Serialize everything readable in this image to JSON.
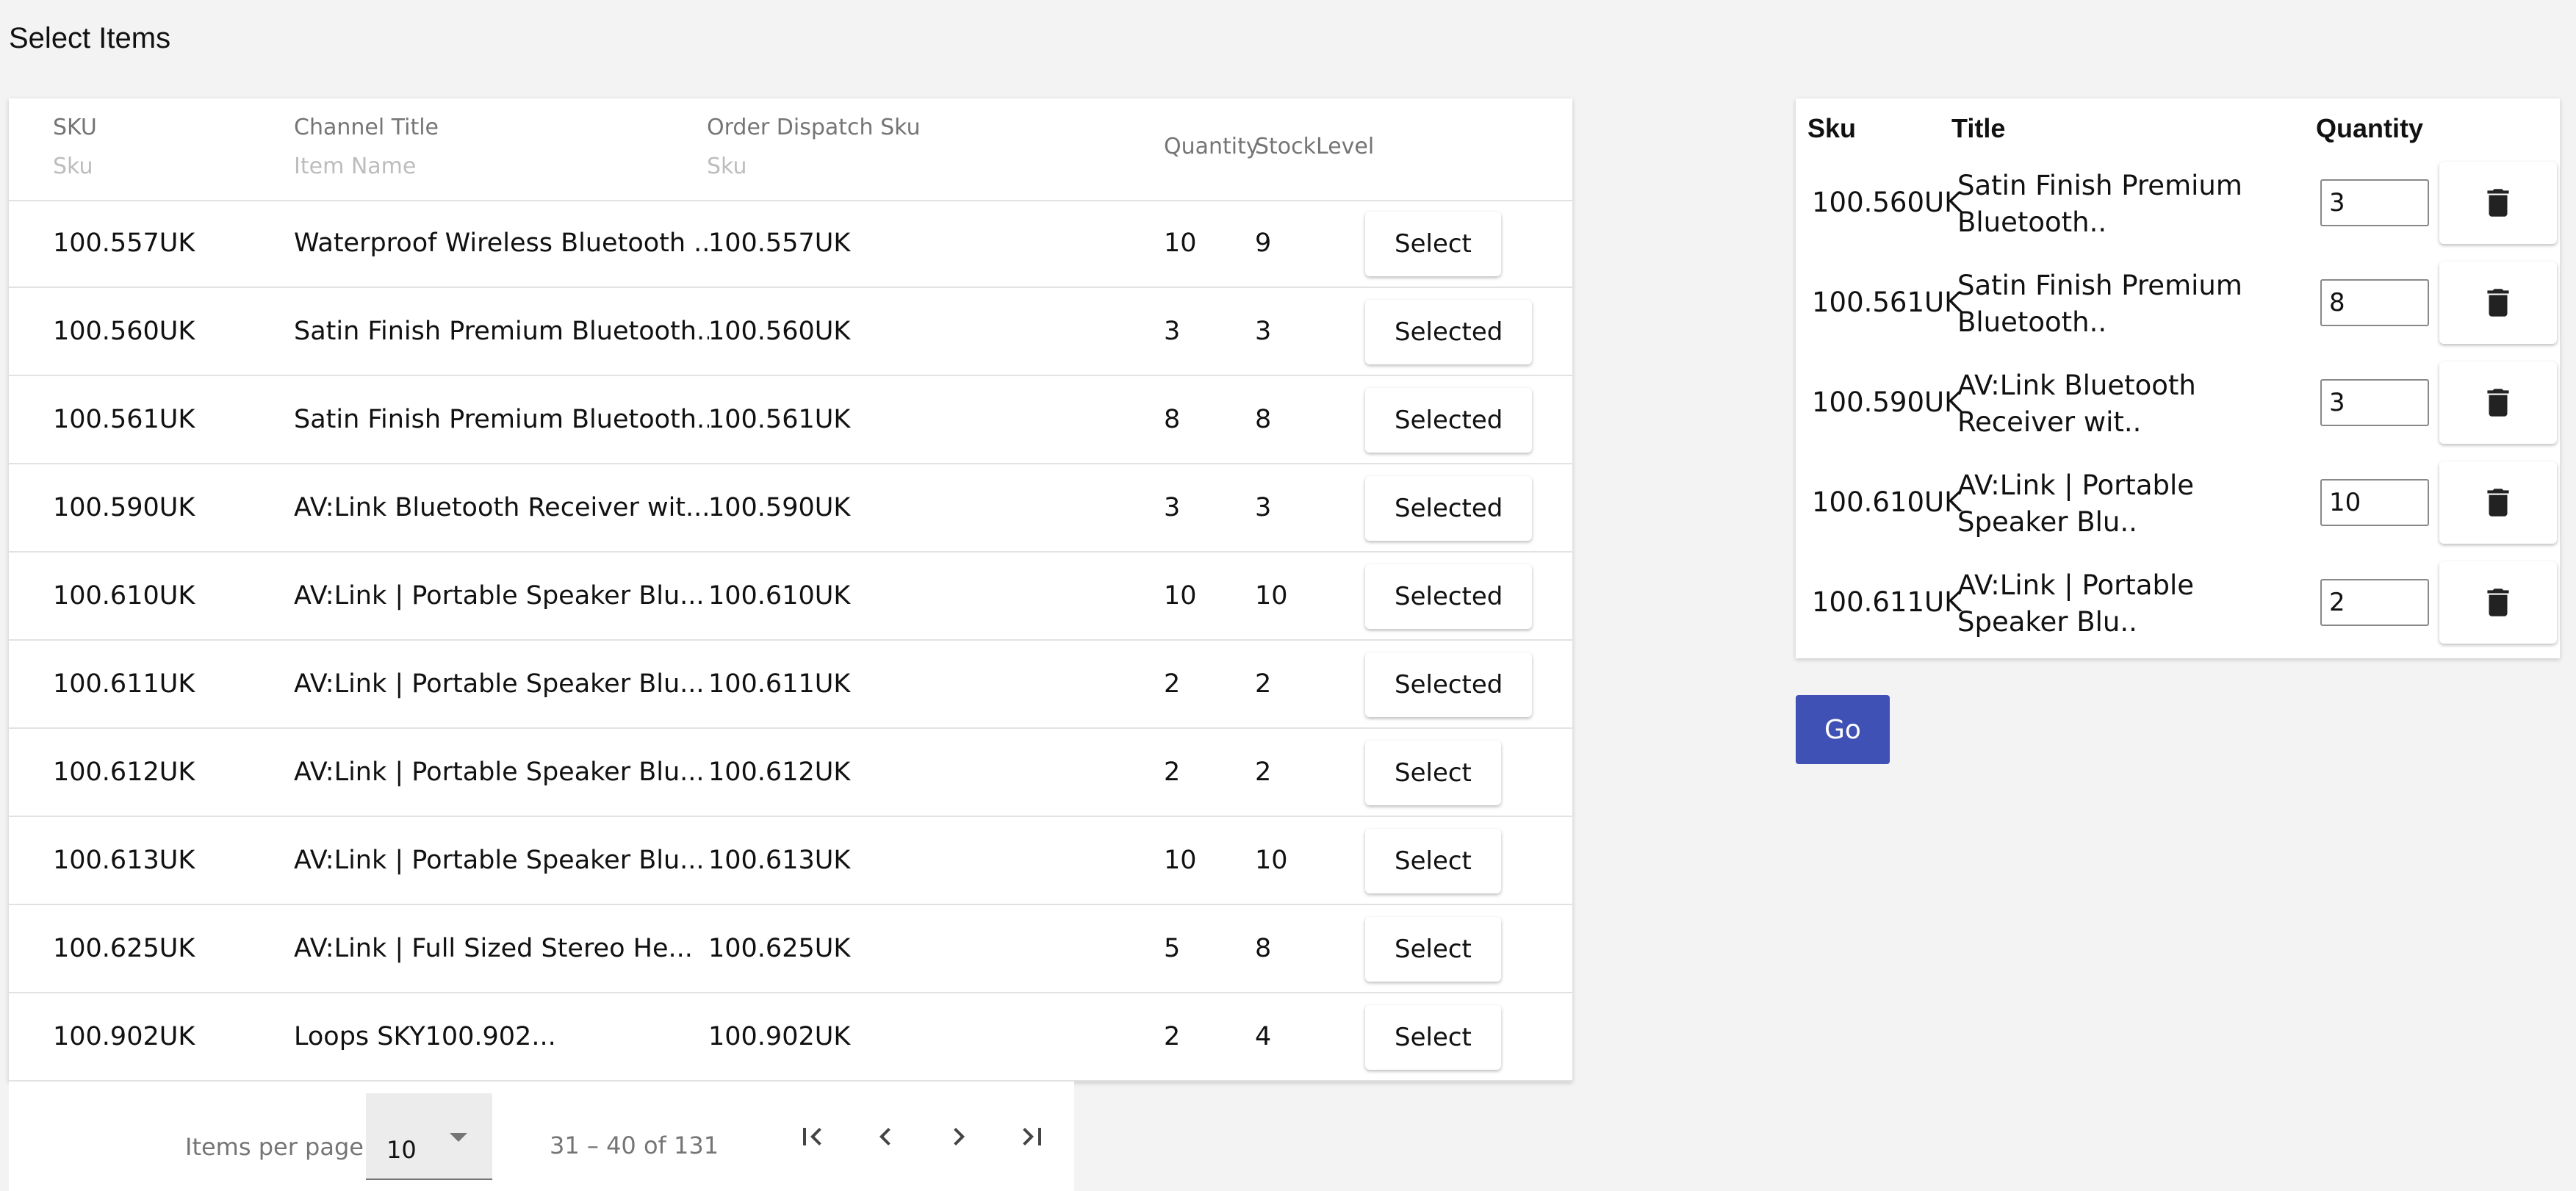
{
  "page": {
    "title": "Select Items"
  },
  "left_table": {
    "headers": {
      "sku": "SKU",
      "sku_sub": "Sku",
      "channel_title": "Channel Title",
      "channel_title_sub": "Item Name",
      "order_dispatch_sku": "Order Dispatch Sku",
      "order_dispatch_sku_sub": "Sku",
      "quantity": "Quantity",
      "stock_level": "StockLevel"
    },
    "rows": [
      {
        "sku": "100.557UK",
        "title": "Waterproof Wireless Bluetooth ...",
        "dispatch_sku": "100.557UK",
        "quantity": "10",
        "stock": "9",
        "action": "Select"
      },
      {
        "sku": "100.560UK",
        "title": "Satin Finish Premium Bluetooth...",
        "dispatch_sku": "100.560UK",
        "quantity": "3",
        "stock": "3",
        "action": "Selected"
      },
      {
        "sku": "100.561UK",
        "title": "Satin Finish Premium Bluetooth...",
        "dispatch_sku": "100.561UK",
        "quantity": "8",
        "stock": "8",
        "action": "Selected"
      },
      {
        "sku": "100.590UK",
        "title": "AV:Link Bluetooth Receiver wit...",
        "dispatch_sku": "100.590UK",
        "quantity": "3",
        "stock": "3",
        "action": "Selected"
      },
      {
        "sku": "100.610UK",
        "title": "AV:Link | Portable Speaker Blu...",
        "dispatch_sku": "100.610UK",
        "quantity": "10",
        "stock": "10",
        "action": "Selected"
      },
      {
        "sku": "100.611UK",
        "title": "AV:Link | Portable Speaker Blu...",
        "dispatch_sku": "100.611UK",
        "quantity": "2",
        "stock": "2",
        "action": "Selected"
      },
      {
        "sku": "100.612UK",
        "title": "AV:Link | Portable Speaker Blu...",
        "dispatch_sku": "100.612UK",
        "quantity": "2",
        "stock": "2",
        "action": "Select"
      },
      {
        "sku": "100.613UK",
        "title": "AV:Link | Portable Speaker Blu...",
        "dispatch_sku": "100.613UK",
        "quantity": "10",
        "stock": "10",
        "action": "Select"
      },
      {
        "sku": "100.625UK",
        "title": "AV:Link | Full Sized Stereo He...",
        "dispatch_sku": "100.625UK",
        "quantity": "5",
        "stock": "8",
        "action": "Select"
      },
      {
        "sku": "100.902UK",
        "title": "Loops SKY100.902...",
        "dispatch_sku": "100.902UK",
        "quantity": "2",
        "stock": "4",
        "action": "Select"
      }
    ]
  },
  "paginator": {
    "items_per_page_label": "Items per page:",
    "items_per_page_value": "10",
    "range_label": "31 – 40 of 131"
  },
  "selected_table": {
    "headers": {
      "sku": "Sku",
      "title": "Title",
      "quantity": "Quantity"
    },
    "rows": [
      {
        "sku": "100.560UK",
        "title": "Satin Finish Premium Bluetooth..",
        "quantity": "3"
      },
      {
        "sku": "100.561UK",
        "title": "Satin Finish Premium Bluetooth..",
        "quantity": "8"
      },
      {
        "sku": "100.590UK",
        "title": "AV:Link Bluetooth Receiver wit..",
        "quantity": "3"
      },
      {
        "sku": "100.610UK",
        "title": "AV:Link | Portable Speaker Blu..",
        "quantity": "10"
      },
      {
        "sku": "100.611UK",
        "title": "AV:Link | Portable Speaker Blu..",
        "quantity": "2"
      }
    ]
  },
  "go_button": {
    "label": "Go"
  },
  "icons": {
    "delete": "trash-icon",
    "first_page": "first-page-icon",
    "prev_page": "chevron-left-icon",
    "next_page": "chevron-right-icon",
    "last_page": "last-page-icon",
    "dropdown": "caret-down-icon"
  },
  "colors": {
    "primary": "#3f51b5",
    "background": "#f3f3f4",
    "header_text": "#757575"
  }
}
